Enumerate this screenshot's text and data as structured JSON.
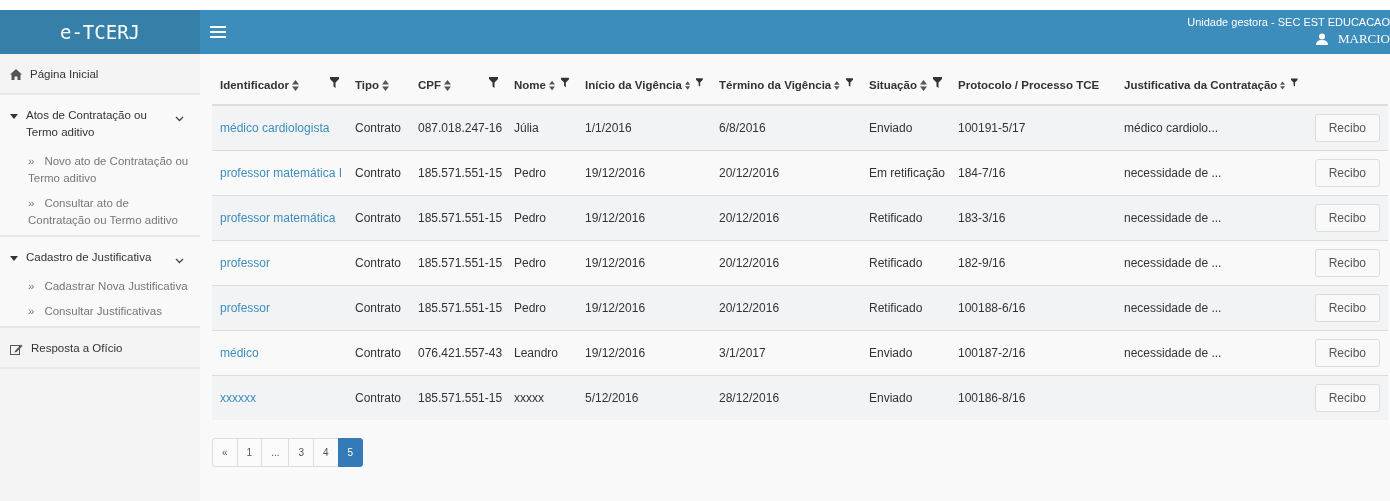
{
  "header": {
    "logo": "e-TCERJ",
    "unit": "Unidade gestora - SEC EST EDUCACAO",
    "user": "MARCIO"
  },
  "sidebar": {
    "items": [
      {
        "label": "Página Inicial"
      },
      {
        "label": "Atos de Contratação ou Termo aditivo",
        "expanded": true,
        "children": [
          {
            "marker": "»",
            "label": "Novo ato de Contratação ou Termo aditivo"
          },
          {
            "marker": "»",
            "label": "Consultar ato de Contratação ou Termo aditivo"
          }
        ]
      },
      {
        "label": "Cadastro de Justificativa",
        "expanded": true,
        "children": [
          {
            "marker": "»",
            "label": "Cadastrar Nova Justificativa"
          },
          {
            "marker": "»",
            "label": "Consultar Justificativas"
          }
        ]
      },
      {
        "label": "Resposta a Ofício"
      }
    ]
  },
  "table": {
    "columns": [
      {
        "label": "Identificador",
        "sortable": true,
        "filterable": true
      },
      {
        "label": "Tipo",
        "sortable": true,
        "filterable": false
      },
      {
        "label": "CPF",
        "sortable": true,
        "filterable": true
      },
      {
        "label": "Nome",
        "sortable": true,
        "filterable": true
      },
      {
        "label": "Início da Vigência",
        "sortable": true,
        "filterable": true
      },
      {
        "label": "Término da Vigência",
        "sortable": true,
        "filterable": true
      },
      {
        "label": "Situação",
        "sortable": true,
        "filterable": true
      },
      {
        "label": "Protocolo / Processo TCE",
        "sortable": false,
        "filterable": false
      },
      {
        "label": "Justificativa da Contratação",
        "sortable": true,
        "filterable": true
      }
    ],
    "rows": [
      {
        "cells": [
          "médico cardiologista",
          "Contrato",
          "087.018.247-16",
          "Júlia",
          "1/1/2016",
          "6/8/2016",
          "Enviado",
          "100191-5/17",
          "médico cardiolo..."
        ],
        "button": "Recibo"
      },
      {
        "cells": [
          "professor matemática I",
          "Contrato",
          "185.571.551-15",
          "Pedro",
          "19/12/2016",
          "20/12/2016",
          "Em retificação",
          "184-7/16",
          "necessidade de ..."
        ],
        "button": "Recibo"
      },
      {
        "cells": [
          "professor matemática",
          "Contrato",
          "185.571.551-15",
          "Pedro",
          "19/12/2016",
          "20/12/2016",
          "Retificado",
          "183-3/16",
          "necessidade de ..."
        ],
        "button": "Recibo"
      },
      {
        "cells": [
          "professor",
          "Contrato",
          "185.571.551-15",
          "Pedro",
          "19/12/2016",
          "20/12/2016",
          "Retificado",
          "182-9/16",
          "necessidade de ..."
        ],
        "button": "Recibo"
      },
      {
        "cells": [
          "professor",
          "Contrato",
          "185.571.551-15",
          "Pedro",
          "19/12/2016",
          "20/12/2016",
          "Retificado",
          "100188-6/16",
          "necessidade de ..."
        ],
        "button": "Recibo"
      },
      {
        "cells": [
          "médico",
          "Contrato",
          "076.421.557-43",
          "Leandro",
          "19/12/2016",
          "3/1/2017",
          "Enviado",
          "100187-2/16",
          "necessidade de ..."
        ],
        "button": "Recibo"
      },
      {
        "cells": [
          "xxxxxx",
          "Contrato",
          "185.571.551-15",
          "xxxxx",
          "5/12/2016",
          "28/12/2016",
          "Enviado",
          "100186-8/16",
          null
        ],
        "button": "Recibo"
      }
    ]
  },
  "pagination": [
    {
      "label": "«",
      "selected": false
    },
    {
      "label": "1",
      "selected": false
    },
    {
      "label": "...",
      "selected": false
    },
    {
      "label": "3",
      "selected": false
    },
    {
      "label": "4",
      "selected": false
    },
    {
      "label": "5",
      "selected": true
    }
  ]
}
